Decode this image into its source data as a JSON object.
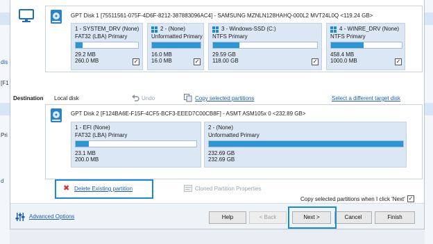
{
  "source_disk": {
    "title": "GPT Disk 1 [75511561-075F-4D6F-8212-387883096AC4] - SAMSUNG MZNLN128HAHQ-000L2 MVT24L0Q  <119.24 GB>",
    "partitions": [
      {
        "name": "1 - SYSTEM_DRV (None)",
        "type": "FAT32 (LBA) Primary",
        "used": "29.2 MB",
        "total": "260.0 MB",
        "fill": 0.11,
        "checked": true
      },
      {
        "name": "2 -  (None)",
        "type": "Unformatted Primary",
        "used": "16.0 MB",
        "total": "16.0 MB",
        "fill": 1.0,
        "checked": true
      },
      {
        "name": "3 - Windows-SSD (C:)",
        "type": "NTFS Primary",
        "used": "29.59 GB",
        "total": "118.00 GB",
        "fill": 0.25,
        "checked": true
      },
      {
        "name": "4 - WINRE_DRV (None)",
        "type": "NTFS Primary",
        "used": "458.4 MB",
        "total": "1000.0 MB",
        "fill": 0.46,
        "checked": true
      }
    ]
  },
  "destination": {
    "label": "Destination",
    "value": "Local disk",
    "undo": "Undo",
    "copy_selected": "Copy selected partitions",
    "select_different": "Select a different target disk",
    "disk_title": "GPT Disk 2 [F124BA6E-F15F-4CF5-BCF3-EEED7C00CB8F] - ASMT    ASM105x          0  <232.89 GB>",
    "partitions": [
      {
        "name": "1 - EFI (None)",
        "type": "FAT32 (LBA) Primary",
        "used": "23.1 MB",
        "total": "200.0 MB",
        "fill": 0.11
      },
      {
        "name": "2 - (None)",
        "type": "Unformatted Primary",
        "used": "232.69 GB",
        "total": "232.69 GB",
        "fill": 1.0
      }
    ]
  },
  "actions": {
    "delete_existing": "Delete Existing partition",
    "cloned_props": "Cloned Partition Properties",
    "copy_when_next": "Copy selected partitions when I click 'Next'"
  },
  "footer": {
    "advanced": "Advanced Options",
    "help": "Help",
    "back": "< Back",
    "next": "Next >",
    "cancel": "Cancel",
    "finish": "Finish"
  },
  "background": {
    "left_text_1": "dis",
    "left_text_2": "[F1",
    "left_text_3": "Pri",
    "left_text_4": "d"
  },
  "colors": {
    "accent": "#1a8ad4",
    "bar": "#2a96d6",
    "partition_bg": "#dbe7f4",
    "link": "#1f5fb3"
  }
}
